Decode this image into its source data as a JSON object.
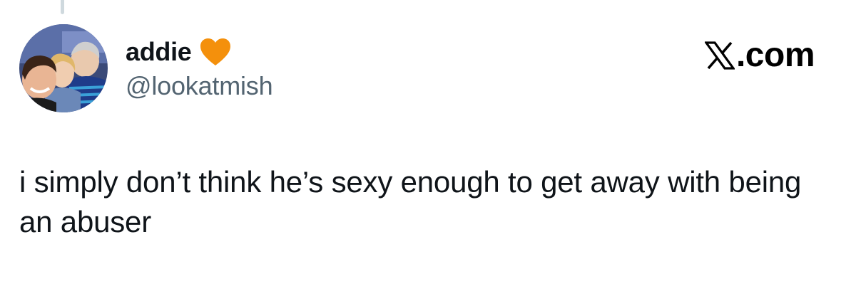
{
  "author": {
    "display_name": "addie",
    "handle": "@lookatmish",
    "avatar": "avatar-photo",
    "badge_icon": "orange-heart-icon"
  },
  "brand": {
    "logo_icon": "x-logo-icon",
    "text": ".com"
  },
  "tweet": {
    "text": "i simply don’t think he’s sexy enough to get away with being an abuser"
  },
  "colors": {
    "heart": "#f4900c",
    "text_primary": "#0f1419",
    "text_secondary": "#536471",
    "thread_line": "#cfd9de"
  }
}
